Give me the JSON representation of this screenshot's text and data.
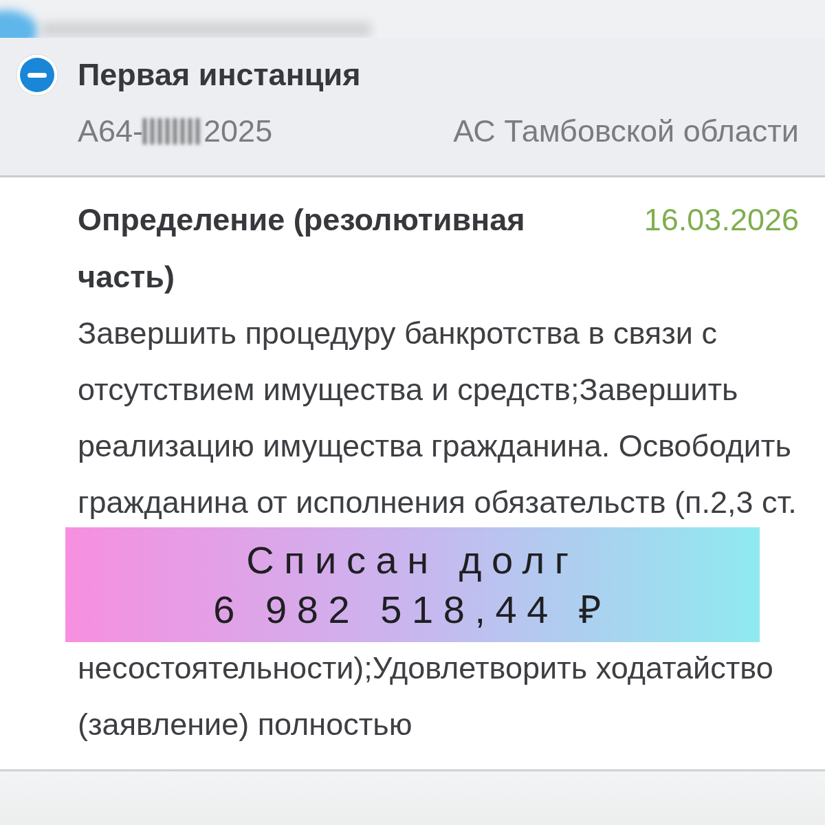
{
  "instance": {
    "title": "Первая инстанция",
    "expanded": true,
    "case_number_start": "А64-",
    "case_number_end": "2025",
    "court": "АС Тамбовской области"
  },
  "document": {
    "title": "Определение (резолютивная часть)",
    "date": "16.03.2026",
    "text_before": [
      "Завершить процедуру банкротства в связи с",
      "отсутствием имущества и средств;Завершить",
      "реализацию имущества гражданина. Освободить",
      "гражданина от исполнения обязательств (п.2,3 ст."
    ],
    "text_after": [
      "несостоятельности);Удовлетворить ходатайство",
      "(заявление) полностью"
    ]
  },
  "banner": {
    "lines": [
      "Списан долг",
      "6 982 518,44 ₽"
    ]
  }
}
